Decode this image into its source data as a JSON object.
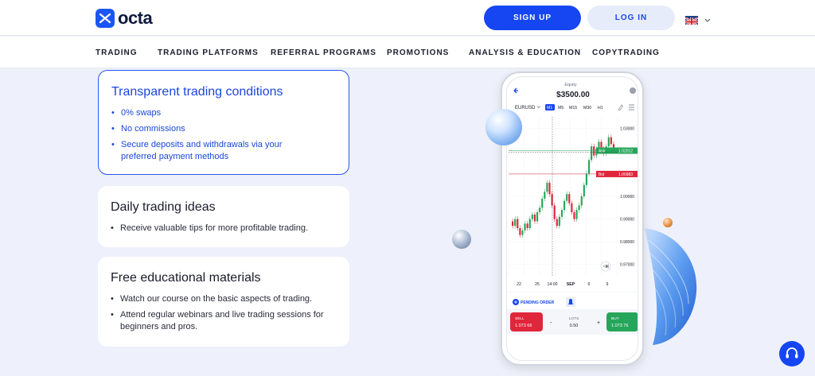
{
  "header": {
    "brand": "octa",
    "signup_label": "SIGN UP",
    "login_label": "LOG IN",
    "language_icon": "uk-flag-icon"
  },
  "nav": {
    "items": [
      "TRADING",
      "TRADING PLATFORMS",
      "REFERRAL PROGRAMS",
      "PROMOTIONS",
      "ANALYSIS & EDUCATION",
      "COPYTRADING"
    ]
  },
  "cards": [
    {
      "title": "Transparent trading conditions",
      "bullets": [
        "0% swaps",
        "No commissions",
        "Secure deposits and withdrawals via your preferred payment methods"
      ]
    },
    {
      "title": "Daily trading ideas",
      "bullets": [
        "Receive valuable tips for more profitable trading."
      ]
    },
    {
      "title": "Free educational materials",
      "bullets": [
        "Watch our course on the basic aspects of trading.",
        "Attend regular webinars and live trading sessions for beginners and pros."
      ]
    }
  ],
  "phone": {
    "equity_label": "Equity",
    "equity_value": "$3500.00",
    "symbol": "EURUSD",
    "timeframes": [
      "M1",
      "M5",
      "M15",
      "M30",
      "H1"
    ],
    "active_timeframe": "M1",
    "ask_label": "Ask",
    "ask_price": "1.02012",
    "bid_label": "Bid",
    "bid_price": "1.00983",
    "price_ticks": [
      "1.03000",
      "1.02000",
      "1.01000",
      "1.00000",
      "0.99000",
      "0.98000",
      "0.97000"
    ],
    "date_ticks": [
      "22",
      "25",
      "14:00",
      "SEP",
      "6",
      "9"
    ],
    "pending_order_label": "PENDING ORDER",
    "sell_label": "SELL",
    "sell_price": "1.073 66",
    "buy_label": "BUY",
    "buy_price": "1.073 76",
    "lots_label": "LOTS",
    "lots_value": "0.50",
    "minus": "-",
    "plus": "+",
    "colors": {
      "up": "#26a65b",
      "down": "#e0263a",
      "accent": "#1646f2"
    }
  }
}
